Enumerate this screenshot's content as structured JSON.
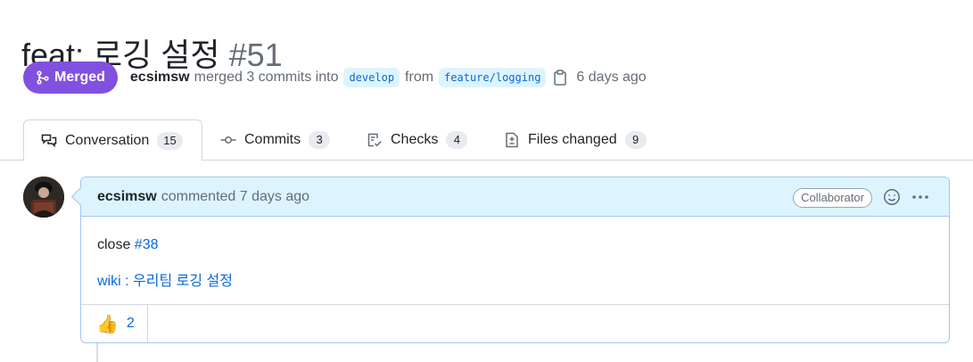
{
  "pr": {
    "title": "feat: 로깅 설정",
    "number": "#51",
    "state": "Merged",
    "author": "ecsimsw",
    "action_text": "merged 3 commits into",
    "base_branch": "develop",
    "from_text": "from",
    "head_branch": "feature/logging",
    "time_ago": "6 days ago"
  },
  "tabs": [
    {
      "label": "Conversation",
      "count": "15",
      "icon": "comment-discussion-icon",
      "active": true
    },
    {
      "label": "Commits",
      "count": "3",
      "icon": "git-commit-icon",
      "active": false
    },
    {
      "label": "Checks",
      "count": "4",
      "icon": "checklist-icon",
      "active": false
    },
    {
      "label": "Files changed",
      "count": "9",
      "icon": "file-diff-icon",
      "active": false
    }
  ],
  "comment": {
    "author": "ecsimsw",
    "meta": "commented 7 days ago",
    "badge": "Collaborator",
    "body_prefix": "close ",
    "issue_link": "#38",
    "wiki_link": "wiki : 우리팀 로깅 설정",
    "reactions": [
      {
        "emoji": "👍",
        "count": "2"
      }
    ]
  },
  "colors": {
    "merged": "#8250df",
    "link": "#0969da",
    "comment_header": "#ddf4ff",
    "comment_border": "#9fc6f5"
  }
}
